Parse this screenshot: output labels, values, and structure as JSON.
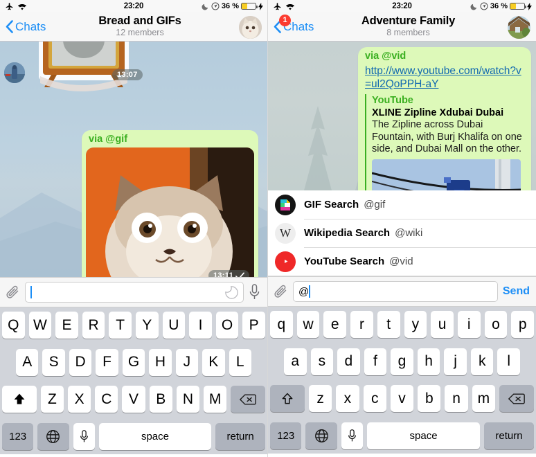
{
  "status_bar": {
    "airplane_icon": "airplane-icon",
    "wifi_icon": "wifi-icon",
    "time": "23:20",
    "dnd_icon": "moon-icon",
    "location_icon": "location-icon",
    "battery_percent": "36 %",
    "battery_icon": "battery-icon",
    "charging_icon": "lightning-bolt-icon"
  },
  "left": {
    "nav": {
      "back_label": "Chats",
      "title": "Bread and GIFs",
      "subtitle": "12 members",
      "avatar_name": "group-avatar-cat"
    },
    "messages": [
      {
        "type": "sticker",
        "time": "13:07"
      },
      {
        "type": "gif",
        "via": "via @gif",
        "time": "13:11",
        "status_icon": "single-check-icon"
      }
    ],
    "input": {
      "attach_icon": "paperclip-icon",
      "value": "",
      "placeholder": "",
      "sticker_icon": "sticker-icon",
      "mic_icon": "microphone-icon"
    },
    "keyboard": {
      "row1": [
        "Q",
        "W",
        "E",
        "R",
        "T",
        "Y",
        "U",
        "I",
        "O",
        "P"
      ],
      "row2": [
        "A",
        "S",
        "D",
        "F",
        "G",
        "H",
        "J",
        "K",
        "L"
      ],
      "row3": [
        "Z",
        "X",
        "C",
        "V",
        "B",
        "N",
        "M"
      ],
      "shift_icon": "shift-filled-icon",
      "backspace_icon": "backspace-icon",
      "numbers_label": "123",
      "globe_icon": "globe-icon",
      "dictation_icon": "microphone-icon",
      "space_label": "space",
      "return_label": "return"
    }
  },
  "right": {
    "nav": {
      "back_label": "Chats",
      "back_badge": "1",
      "title": "Adventure Family",
      "subtitle": "8 members",
      "avatar_name": "group-avatar-house"
    },
    "message": {
      "via": "via @vid",
      "url": "http://www.youtube.com/watch?v=ul2QoPPH-aY",
      "webpage": {
        "site": "YouTube",
        "title": "XLINE Zipline Xdubai Dubai",
        "description": "The Zipline across Dubai Fountain, with Burj Khalifa on one side, and Dubai Mall on the other.",
        "photo_name": "zipline-preview-photo"
      }
    },
    "bots": [
      {
        "name": "GIF Search",
        "handle": "@gif",
        "icon": "gif-bot-icon",
        "icon_bg": "#141414"
      },
      {
        "name": "Wikipedia Search",
        "handle": "@wiki",
        "icon": "wikipedia-bot-icon",
        "icon_bg": "#eeeeee"
      },
      {
        "name": "YouTube Search",
        "handle": "@vid",
        "icon": "youtube-bot-icon",
        "icon_bg": "#ef2828"
      }
    ],
    "input": {
      "attach_icon": "paperclip-icon",
      "value": "@",
      "send_label": "Send"
    },
    "keyboard": {
      "row1": [
        "q",
        "w",
        "e",
        "r",
        "t",
        "y",
        "u",
        "i",
        "o",
        "p"
      ],
      "row2": [
        "a",
        "s",
        "d",
        "f",
        "g",
        "h",
        "j",
        "k",
        "l"
      ],
      "row3": [
        "z",
        "x",
        "c",
        "v",
        "b",
        "n",
        "m"
      ],
      "shift_icon": "shift-outline-icon",
      "backspace_icon": "backspace-icon",
      "numbers_label": "123",
      "globe_icon": "globe-icon",
      "dictation_icon": "microphone-icon",
      "space_label": "space",
      "return_label": "return"
    }
  },
  "colors": {
    "accent": "#1c8ef6",
    "bubble_out": "#ddf9b9",
    "via_green": "#3aaf20",
    "badge_red": "#fc3b30",
    "battery_yellow": "#f7cd23"
  }
}
